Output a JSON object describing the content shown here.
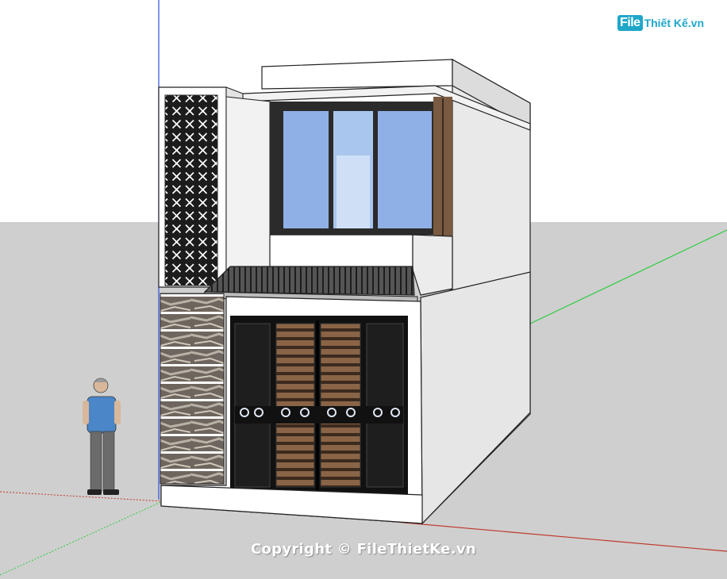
{
  "watermark": {
    "logo_file": "File",
    "logo_rest": "Thiết Kế.vn",
    "copyright": "Copyright © FileThietKe.vn"
  },
  "colors": {
    "sky": "#ffffff",
    "ground": "#cfcfcf",
    "wall": "#ffffff",
    "side_wall": "#e9e9e9",
    "glass": "#8fb0e6",
    "wood": "#7a5a40",
    "frame": "#2b2b2b",
    "axis_red": "#c0392b",
    "axis_green": "#2ecc40",
    "axis_blue": "#2d4fd8",
    "logo": "#1ea7c9"
  }
}
